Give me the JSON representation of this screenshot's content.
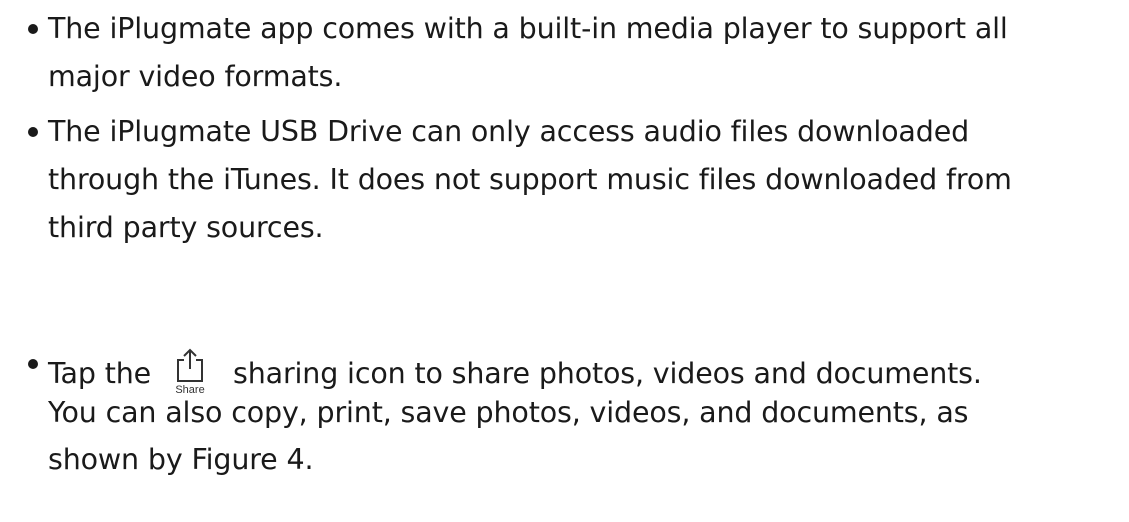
{
  "bullets": [
    {
      "lines": [
        "The iPlugmate app comes with a built-in media player to support all",
        "major video formats."
      ]
    },
    {
      "lines": [
        "The iPlugmate USB Drive can only access audio files downloaded",
        "through the iTunes. It does not support music files downloaded from",
        "third party sources."
      ]
    },
    {
      "lead": "Tap the",
      "icon": {
        "name": "share-icon",
        "caption": "Share"
      },
      "trail": "sharing icon to share photos, videos and documents.",
      "lines": [
        "You can also copy, print, save photos, videos, and documents, as",
        "shown by Figure 4."
      ]
    }
  ]
}
